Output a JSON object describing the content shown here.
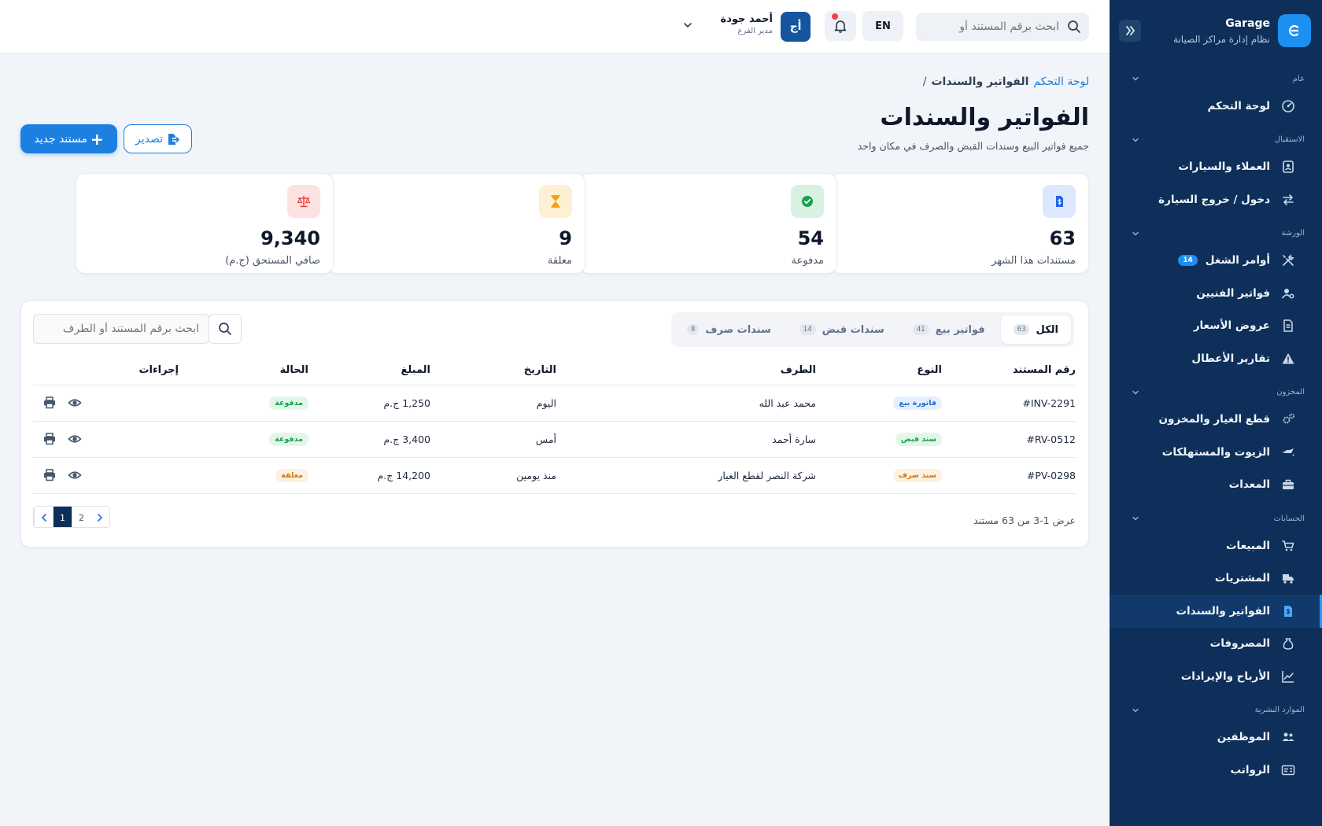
{
  "brand": {
    "name": "Garage",
    "subtitle": "نظام إدارة مراكز الصيانة"
  },
  "sidebar": {
    "sections": [
      {
        "label": "عام",
        "items": [
          {
            "label": "لوحة التحكم",
            "icon": "dashboard-icon"
          }
        ]
      },
      {
        "label": "الاستقبال",
        "items": [
          {
            "label": "العملاء والسيارات",
            "icon": "contacts-icon"
          },
          {
            "label": "دخول / خروج السيارة",
            "icon": "exchange-icon"
          }
        ]
      },
      {
        "label": "الورشة",
        "items": [
          {
            "label": "أوامر الشغل",
            "icon": "tools-icon",
            "badge": "14"
          },
          {
            "label": "فواتير الفنيين",
            "icon": "user-gear-icon"
          },
          {
            "label": "عروض الأسعار",
            "icon": "document-icon"
          },
          {
            "label": "تقارير الأعطال",
            "icon": "warning-icon"
          }
        ]
      },
      {
        "label": "المخزون",
        "items": [
          {
            "label": "قطع الغيار والمخزون",
            "icon": "gears-icon"
          },
          {
            "label": "الزيوت والمستهلكات",
            "icon": "oil-can-icon"
          },
          {
            "label": "المعدات",
            "icon": "toolbox-icon"
          }
        ]
      },
      {
        "label": "الحسابات",
        "items": [
          {
            "label": "المبيعات",
            "icon": "cart-icon"
          },
          {
            "label": "المشتريات",
            "icon": "truck-icon"
          },
          {
            "label": "الفواتير والسندات",
            "icon": "invoice-icon",
            "active": true
          },
          {
            "label": "المصروفات",
            "icon": "money-bag-icon"
          },
          {
            "label": "الأرباح والإيرادات",
            "icon": "chart-line-icon"
          }
        ]
      },
      {
        "label": "الموارد البشرية",
        "items": [
          {
            "label": "الموظفين",
            "icon": "users-icon"
          },
          {
            "label": "الرواتب",
            "icon": "id-card-icon"
          }
        ]
      }
    ]
  },
  "header": {
    "search_placeholder": "ابحث برقم المستند أو",
    "lang": "EN",
    "avatar": "أج",
    "user_name": "أحمد جودة",
    "user_role": "مدير الفرع"
  },
  "breadcrumb": {
    "home": "لوحة التحكم",
    "sep": "/",
    "current": "الفواتير والسندات"
  },
  "page": {
    "title": "الفواتير والسندات",
    "subtitle": "جميع فواتير البيع وسندات القبض والصرف في مكان واحد",
    "new_button": "مستند جديد",
    "new_plus": "+",
    "export_button": "تصدير"
  },
  "stats": [
    {
      "value": "63",
      "label": "مستندات هذا الشهر",
      "color": "#2563eb",
      "bg": "#dbe8fd",
      "icon": "invoice-dollar-icon"
    },
    {
      "value": "54",
      "label": "مدفوعة",
      "color": "#16a34a",
      "bg": "#d9f1e2",
      "icon": "check-circle-icon"
    },
    {
      "value": "9",
      "label": "معلقة",
      "color": "#f59e0b",
      "bg": "#fdf0d3",
      "icon": "hourglass-icon"
    },
    {
      "value": "9,340",
      "label": "صافي المستحق (ج.م)",
      "color": "#ef4444",
      "bg": "#fde2e2",
      "icon": "scale-icon"
    }
  ],
  "tabs": [
    {
      "label": "الكل",
      "count": "63",
      "active": true
    },
    {
      "label": "فواتير بيع",
      "count": "41"
    },
    {
      "label": "سندات قبض",
      "count": "14"
    },
    {
      "label": "سندات صرف",
      "count": "8"
    }
  ],
  "table_search": {
    "placeholder": "ابحث برقم المستند أو الطرف"
  },
  "table": {
    "headers": {
      "number": "رقم المستند",
      "type": "النوع",
      "party": "الطرف",
      "date": "التاريخ",
      "amount": "المبلغ",
      "status": "الحالة",
      "actions": "إجراءات"
    },
    "rows": [
      {
        "number": "#INV-2291",
        "type": "فاتورة بيع",
        "type_color": "blue",
        "party": "محمد عبد الله",
        "date": "اليوم",
        "amount": "1,250 ج.م",
        "status": "مدفوعة",
        "status_color": "green"
      },
      {
        "number": "#RV-0512",
        "type": "سند قبض",
        "type_color": "green",
        "party": "سارة أحمد",
        "date": "أمس",
        "amount": "3,400 ج.م",
        "status": "مدفوعة",
        "status_color": "green"
      },
      {
        "number": "#PV-0298",
        "type": "سند صرف",
        "type_color": "orange",
        "party": "شركة النصر لقطع الغيار",
        "date": "منذ يومين",
        "amount": "14,200 ج.م",
        "status": "معلقة",
        "status_color": "orange"
      }
    ]
  },
  "pagination": {
    "summary": "عرض 1-3 من 63 مستند",
    "pages": [
      "1",
      "2"
    ],
    "current": "1"
  }
}
